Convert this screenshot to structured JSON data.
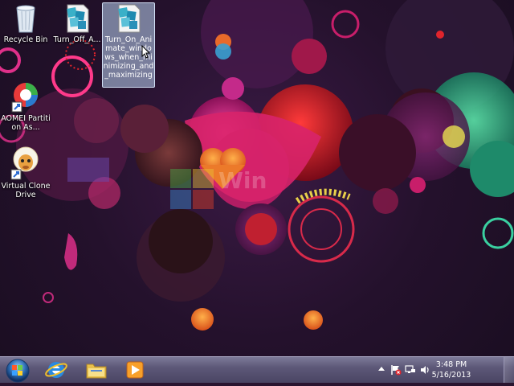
{
  "desktop": {
    "icons": [
      {
        "label": "Recycle Bin",
        "icon": "recycle-bin-icon"
      },
      {
        "label": "Turn_Off_A...",
        "icon": "registry-file-icon"
      },
      {
        "label": "Turn_On_Animate_windows_when_minimizing_and_maximizing",
        "icon": "registry-file-icon"
      },
      {
        "label": "AOMEI Partition As...",
        "icon": "aomei-partition-icon"
      },
      {
        "label": "Virtual CloneDrive",
        "icon": "virtual-clonedrive-sheep-icon"
      }
    ],
    "watermark": "Win"
  },
  "taskbar": {
    "start_label": "Start",
    "pinned": [
      {
        "name": "Internet Explorer",
        "icon": "internet-explorer-icon"
      },
      {
        "name": "Windows Explorer",
        "icon": "folder-icon"
      },
      {
        "name": "Windows Media Player",
        "icon": "media-player-icon"
      }
    ],
    "tray_icons": [
      "show-hidden-icons-arrow",
      "action-center-flag-icon",
      "network-icon",
      "volume-icon"
    ],
    "time": "3:48 PM",
    "date": "5/16/2013"
  },
  "colors": {
    "taskbar": "#5d5878",
    "selection": "#bed7f5",
    "accent_red": "#e0242c",
    "accent_pink": "#e0308a",
    "accent_green": "#2fd28a"
  }
}
